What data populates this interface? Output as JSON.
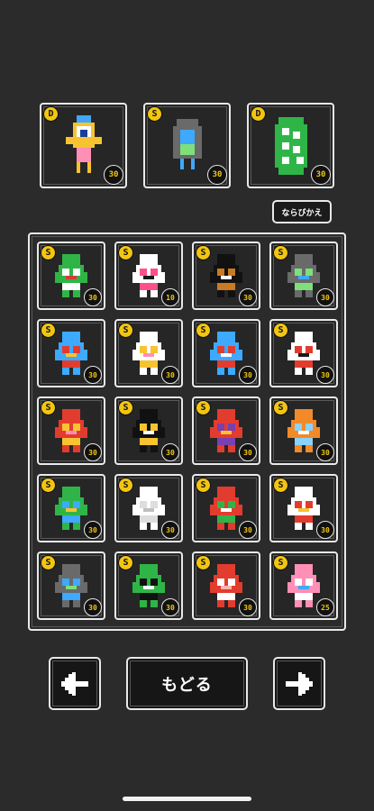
{
  "top_slots": [
    {
      "name": "top-slot-1",
      "rank": "D",
      "level": "30"
    },
    {
      "name": "top-slot-2",
      "rank": "S",
      "level": "30"
    },
    {
      "name": "top-slot-3",
      "rank": "D",
      "level": "30"
    }
  ],
  "sort_label": "ならびかえ",
  "grid": [
    {
      "rank": "S",
      "level": "30"
    },
    {
      "rank": "S",
      "level": "10"
    },
    {
      "rank": "S",
      "level": "30"
    },
    {
      "rank": "S",
      "level": "30"
    },
    {
      "rank": "S",
      "level": "30"
    },
    {
      "rank": "S",
      "level": "30"
    },
    {
      "rank": "S",
      "level": "30"
    },
    {
      "rank": "S",
      "level": "30"
    },
    {
      "rank": "S",
      "level": "30"
    },
    {
      "rank": "S",
      "level": "30"
    },
    {
      "rank": "S",
      "level": "30"
    },
    {
      "rank": "S",
      "level": "30"
    },
    {
      "rank": "S",
      "level": "30"
    },
    {
      "rank": "S",
      "level": "30"
    },
    {
      "rank": "S",
      "level": "30"
    },
    {
      "rank": "S",
      "level": "30"
    },
    {
      "rank": "S",
      "level": "30"
    },
    {
      "rank": "S",
      "level": "30"
    },
    {
      "rank": "S",
      "level": "30"
    },
    {
      "rank": "S",
      "level": "25"
    }
  ],
  "nav": {
    "back_label": "もどる",
    "prev_icon": "arrow-left-icon",
    "next_icon": "arrow-right-icon"
  },
  "colors": {
    "background": "#2b2b2b",
    "border": "#e9e9e9",
    "badge": "#f2c511"
  }
}
